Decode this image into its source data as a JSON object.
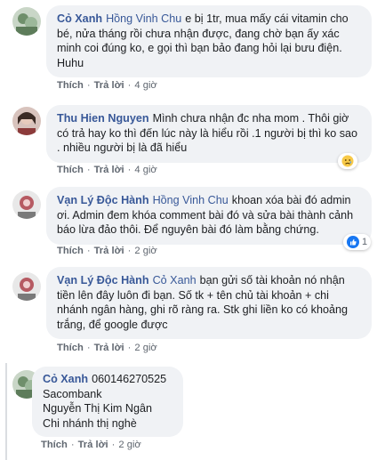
{
  "comments": [
    {
      "author": "Cỏ Xanh",
      "mention": "Hồng Vinh Chu",
      "text": "e bị 1tr, mua mấy cái vitamin cho bé, nửa tháng rồi chưa nhận được, đang chờ bạn ấy xác minh coi đúng ko, e gọi thì bạn bảo đang hỏi lại bưu điện. Huhu",
      "like": "Thích",
      "reply": "Trả lời",
      "time": "4 giờ"
    },
    {
      "author": "Thu Hien Nguyen",
      "mention": "",
      "text": "Mình chưa nhận đc nha mom . Thôi giờ có trả hay ko thì đến lúc này là hiểu rồi .1 người bị thì ko sao . nhiều người bị là đã hiểu",
      "like": "Thích",
      "reply": "Trả lời",
      "time": "4 giờ",
      "reaction_icon": "sad-face-icon"
    },
    {
      "author": "Vạn Lý Độc Hành",
      "mention": "Hồng Vinh Chu",
      "text": "khoan xóa bài đó admin ơi. Admin đem khóa comment bài đó và sửa bài thành cảnh báo lừa đảo thôi. Để nguyên bài đó làm bằng chứng.",
      "like": "Thích",
      "reply": "Trả lời",
      "time": "2 giờ",
      "reaction_icon": "like-thumb-icon",
      "reaction_count": "1"
    },
    {
      "author": "Vạn Lý Độc Hành",
      "mention": "Cỏ Xanh",
      "text": "bạn gửi số tài khoản nó nhận tiền lên đây luôn đi bạn. Số tk + tên chủ tài khoản + chi nhánh ngân hàng, ghi rõ ràng ra. Stk ghi liền ko có khoảng trắng, để google được",
      "like": "Thích",
      "reply": "Trả lời",
      "time": "2 giờ"
    },
    {
      "author": "Cỏ Xanh",
      "mention": "",
      "lines": [
        "060146270525",
        "Sacombank",
        "Nguyễn Thị Kim Ngân",
        "Chi nhánh thị nghè"
      ],
      "like": "Thích",
      "reply": "Trả lời",
      "time": "2 giờ"
    }
  ],
  "colors": {
    "link": "#385898",
    "bubble": "#f0f2f5",
    "meta": "#606770",
    "like_blue": "#1877f2"
  }
}
